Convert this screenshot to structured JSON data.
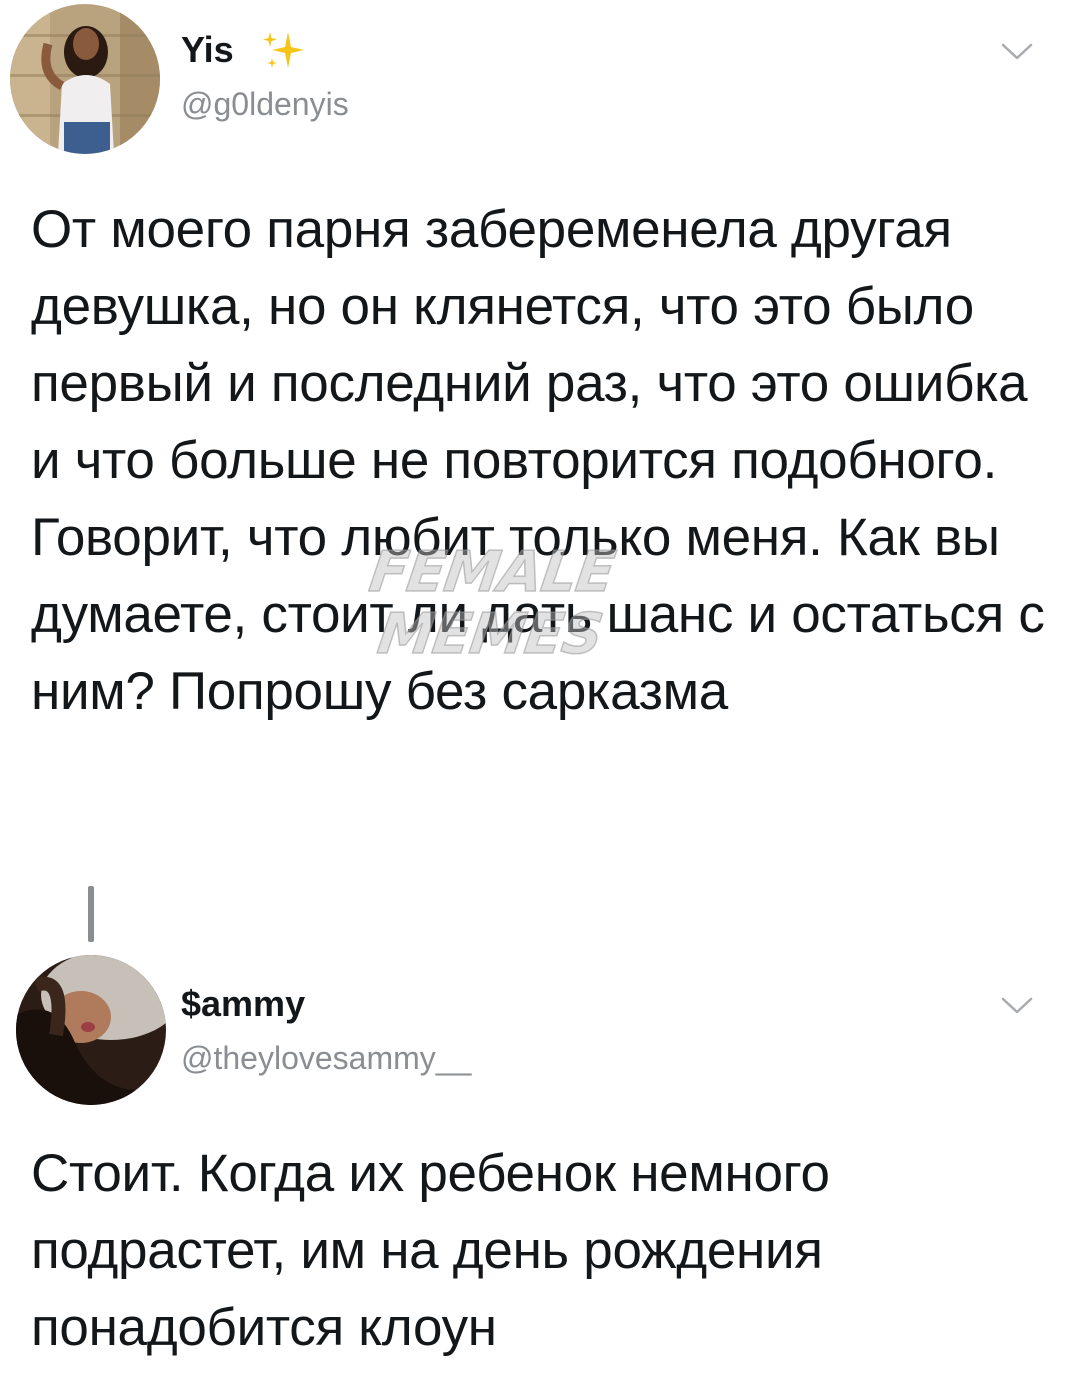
{
  "tweets": [
    {
      "display_name": "Yis",
      "name_emoji": "sparkles-icon",
      "handle": "@g0ldenyis",
      "text": "От моего парня забеременела другая девушка, но он клянется, что это было первый и последний раз, что это ошибка и что больше не повторится подобного. Говорит, что любит только меня. Как вы думаете, стоит ли дать шанс и остаться с ним? Попрошу без сарказма",
      "menu_icon": "chevron-down-icon"
    },
    {
      "display_name": "$ammy",
      "handle": "@theylovesammy__",
      "text": "Стоит. Когда их ребенок немного подрастет, им на день рождения понадобится клоун",
      "menu_icon": "chevron-down-icon"
    }
  ],
  "watermark": {
    "line1": "FEMALE",
    "line2": "MEMES"
  },
  "colors": {
    "text": "#14171a",
    "secondary": "#8a8d91",
    "sparkle": "#f5c518"
  }
}
